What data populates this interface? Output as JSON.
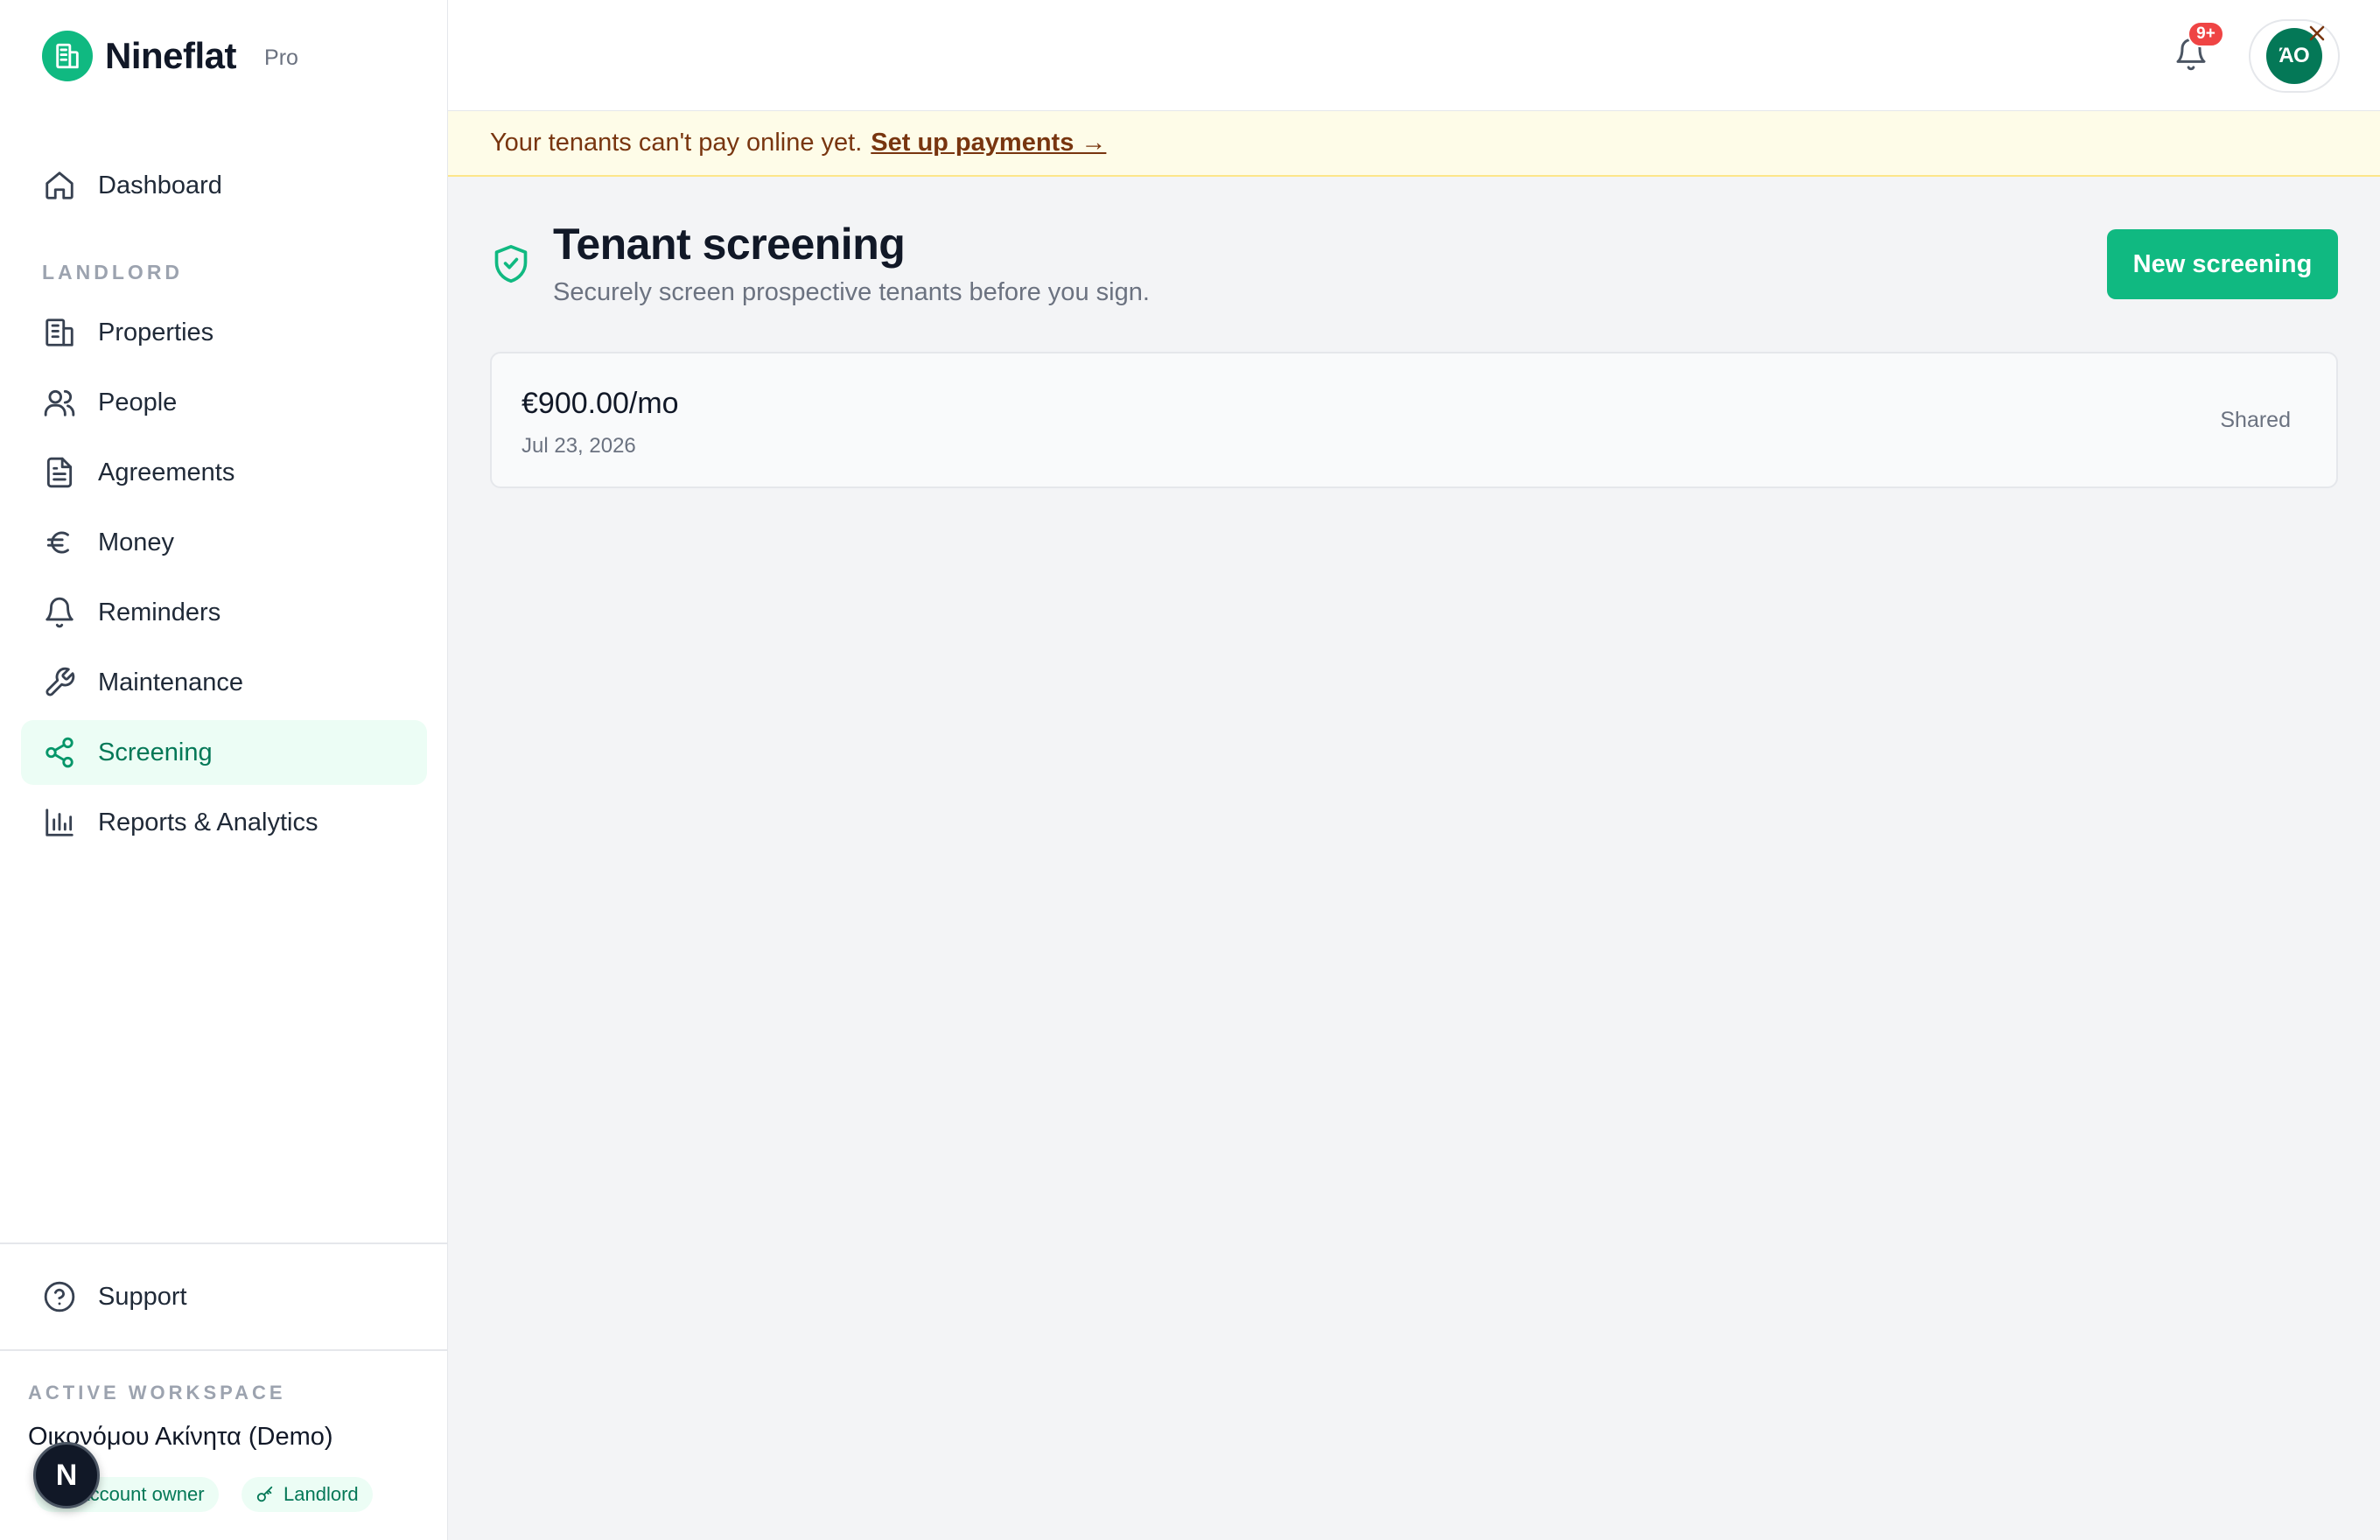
{
  "brand": {
    "name": "Nineflat",
    "tier": "Pro"
  },
  "sidebar": {
    "top_item": {
      "label": "Dashboard",
      "icon": "home-icon"
    },
    "section_label": "LANDLORD",
    "items": [
      {
        "label": "Properties",
        "icon": "building-icon"
      },
      {
        "label": "People",
        "icon": "users-icon"
      },
      {
        "label": "Agreements",
        "icon": "document-icon"
      },
      {
        "label": "Money",
        "icon": "euro-icon"
      },
      {
        "label": "Reminders",
        "icon": "bell-icon"
      },
      {
        "label": "Maintenance",
        "icon": "wrench-icon"
      },
      {
        "label": "Screening",
        "icon": "share-nodes-icon",
        "active": true
      },
      {
        "label": "Reports & Analytics",
        "icon": "bar-chart-icon"
      }
    ],
    "support": {
      "label": "Support",
      "icon": "help-circle-icon"
    },
    "workspace": {
      "label": "ACTIVE WORKSPACE",
      "name": "Οικονόμου Ακίνητα (Demo)",
      "roles": [
        "Account owner",
        "Landlord"
      ]
    },
    "floating_badge": "N"
  },
  "topbar": {
    "notification_count": "9+",
    "avatar_initials": "ΆΟ"
  },
  "banner": {
    "text": "Your tenants can't pay online yet.",
    "link": "Set up payments →"
  },
  "page": {
    "title": "Tenant screening",
    "subtitle": "Securely screen prospective tenants before you sign.",
    "primary_action": "New screening"
  },
  "screenings": [
    {
      "amount": "€900.00/mo",
      "date": "Jul 23, 2026",
      "status": "Shared"
    }
  ],
  "colors": {
    "accent": "#10b981",
    "accent_dark": "#047857",
    "active_bg": "#ecfdf5",
    "banner_bg": "#fefce8",
    "badge_red": "#ef4444"
  }
}
